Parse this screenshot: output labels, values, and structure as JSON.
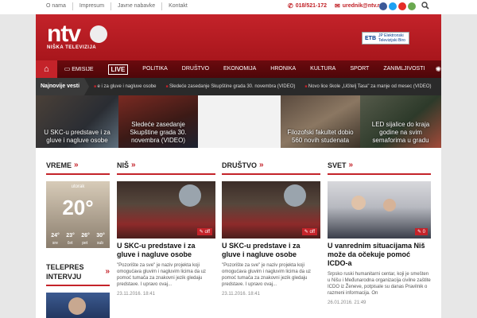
{
  "topbar": {
    "links": [
      "O nama",
      "Impresum",
      "Javne nabavke",
      "Kontakt"
    ],
    "phone": "018/521-172",
    "email": "urednik@ntv.rs",
    "social_colors": [
      "#3b5998",
      "#1da1f2",
      "#e52d27",
      "#6aa84f"
    ]
  },
  "header": {
    "logo_word": "ntv",
    "logo_tag": "NIŠKA TELEVIZIJA",
    "etb_logo": "ETB",
    "etb_text": "JP Elektronski Televizijski Biro",
    "brand_color": "#c4232a"
  },
  "nav": {
    "emisije": "EMISIJE",
    "live": "LIVE",
    "items": [
      "POLITIKA",
      "DRUŠTVO",
      "EKONOMIJA",
      "HRONIKA",
      "KULTURA",
      "SPORT",
      "ZANIMLJIVOSTI"
    ]
  },
  "ticker": {
    "label": "Najnovije vesti",
    "items": [
      "e i za gluve i nagluve osobe",
      "Sledeće zasedanje Skupštine grada 30. novembra (VIDEO)",
      "Novo lice škole „Učitelj Tasa\" za manje od mesec (VIDEO)"
    ]
  },
  "strip": [
    {
      "caption": "U SKC-u predstave i za gluve i nagluve osobe"
    },
    {
      "caption": "Sledeće zasedanje Skupštine grada 30. novembra (VIDEO)"
    },
    {
      "caption": ""
    },
    {
      "caption": "Filozofski fakultet dobio 560 novih studenata"
    },
    {
      "caption": "LED sijalice do kraja godine na svim semaforima u gradu"
    }
  ],
  "vreme": {
    "heading": "VREME",
    "day": "utorak",
    "temp": "20°",
    "forecast": [
      "24°",
      "23°",
      "26°",
      "30°"
    ],
    "days": [
      "sre",
      "čet",
      "pet",
      "sub"
    ]
  },
  "telepres": {
    "heading": "TELEPRES INTERVJU"
  },
  "nis": {
    "heading": "NIŠ",
    "badge": "off",
    "title": "U SKC-u predstave i za gluve i nagluve osobe",
    "excerpt": "\"Pozorište za sve\" je naziv projekta koji omogućava gluvim i nagluvim licima da uz pomoć tumača za znakovni jezik gledaju predstave. I upravo ovaj...",
    "date": "23.11.2016. 18:41"
  },
  "drustvo": {
    "heading": "DRUŠTVO",
    "badge": "off",
    "title": "U SKC-u predstave i za gluve i nagluve osobe",
    "excerpt": "\"Pozorište za sve\" je naziv projekta koji omogućava gluvim i nagluvim licima da uz pomoć tumača za znakovni jezik gledaju predstave. I upravo ovaj...",
    "date": "23.11.2016. 18:41"
  },
  "svet": {
    "heading": "SVET",
    "badge": "0",
    "title": "U vanrednim situacijama Niš može da očekuje pomoć ICDO-a",
    "excerpt": "Srpsko ruski humanitarni centar, koji je smešten u Nišu i Međunarodna organizacija civilne zaštite ICDO iz Ženeve, potpisale su danas Pravilnik o razmeni informacija. On",
    "date": "26.01.2016. 21:49"
  }
}
